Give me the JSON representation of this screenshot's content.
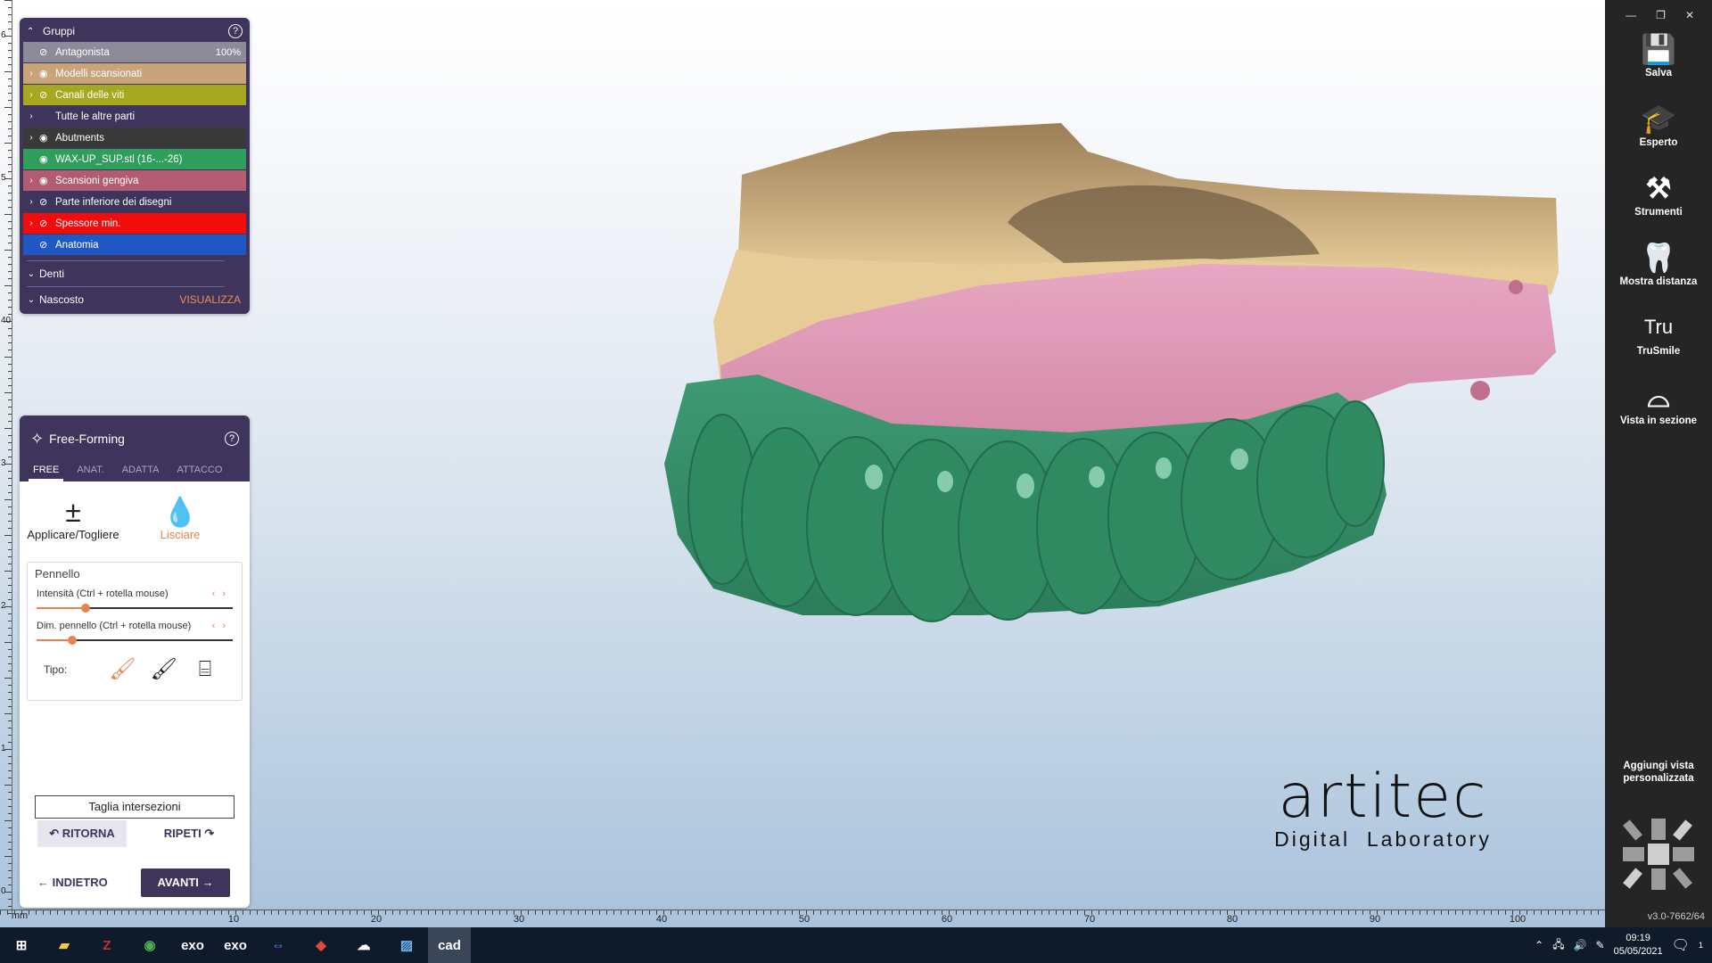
{
  "groups_panel": {
    "title": "Gruppi",
    "help": "?",
    "rows": [
      {
        "label": "Antagonista",
        "value": "100%",
        "color": "#8e8b99",
        "expandable": false,
        "eye": "hidden"
      },
      {
        "label": "Modelli scansionati",
        "color": "#c9a37a",
        "expandable": true,
        "eye": "visible"
      },
      {
        "label": "Canali delle viti",
        "color": "#a6a81f",
        "expandable": true,
        "eye": "hidden"
      },
      {
        "label": "Tutte le altre parti",
        "color": "#3e345c",
        "expandable": true,
        "eye": "none"
      },
      {
        "label": "Abutments",
        "color": "#393939",
        "expandable": true,
        "eye": "visible"
      },
      {
        "label": "WAX-UP_SUP.stl (16-...-26)",
        "color": "#2f9e5b",
        "expandable": false,
        "eye": "visible"
      },
      {
        "label": "Scansioni gengiva",
        "color": "#b25c72",
        "expandable": true,
        "eye": "visible"
      },
      {
        "label": "Parte inferiore dei disegni",
        "color": "#3e345c",
        "expandable": true,
        "eye": "hidden"
      },
      {
        "label": "Spessore min.",
        "color": "#f20d0d",
        "expandable": true,
        "eye": "hidden"
      },
      {
        "label": "Anatomia",
        "color": "#1f58c4",
        "expandable": false,
        "eye": "hidden"
      }
    ],
    "denti": "Denti",
    "nascosto": "Nascosto",
    "visualizza": "VISUALIZZA"
  },
  "free_forming": {
    "title": "Free-Forming",
    "help": "?",
    "tabs": [
      "FREE",
      "ANAT.",
      "ADATTA",
      "ATTACCO"
    ],
    "active_tab": "FREE",
    "tools": [
      {
        "label": "Applicare/Togliere",
        "icon": "plus-minus-icon"
      },
      {
        "label": "Lisciare",
        "icon": "drop-icon",
        "active": true
      }
    ],
    "brush_title": "Pennello",
    "sliders": [
      {
        "label": "Intensità (Ctrl + rotella mouse)",
        "value": 0.25
      },
      {
        "label": "Dim. pennello (Ctrl + rotella mouse)",
        "value": 0.18
      }
    ],
    "tipo_label": "Tipo:",
    "taglia": "Taglia intersezioni",
    "ritorna": "RITORNA",
    "ripeti": "RIPETI",
    "indietro": "INDIETRO",
    "avanti": "AVANTI"
  },
  "sidebar": {
    "items": [
      {
        "label": "Salva",
        "icon": "save-icon"
      },
      {
        "label": "Esperto",
        "icon": "graduation-cap-icon"
      },
      {
        "label": "Strumenti",
        "icon": "tools-icon"
      },
      {
        "label": "Mostra distanza",
        "icon": "tooth-distance-icon"
      },
      {
        "label": "TruSmile",
        "icon": "trusmile-icon"
      },
      {
        "label": "Vista in sezione",
        "icon": "section-view-icon"
      }
    ],
    "trusmile_mark": "Tru",
    "add_view": "Aggiungi vista personalizzata",
    "version": "v3.0-7662/64"
  },
  "rulers": {
    "unit": "mm",
    "x_labels": [
      "10",
      "20",
      "30",
      "40",
      "50",
      "60",
      "70",
      "80",
      "90",
      "100"
    ],
    "y_labels": [
      "6",
      "5",
      "40",
      "3",
      "2",
      "1",
      "0"
    ]
  },
  "logo": {
    "name": "artitec",
    "tagline": "Digital  Laboratory"
  },
  "taskbar": {
    "apps": [
      "exo",
      "exo",
      "cad"
    ],
    "time": "09:19",
    "date": "05/05/2021",
    "notifications": "1"
  },
  "colors": {
    "panel": "#3e345c",
    "accent": "#e8824f",
    "sidebar": "#252525",
    "taskbar": "#0f1a2a"
  }
}
